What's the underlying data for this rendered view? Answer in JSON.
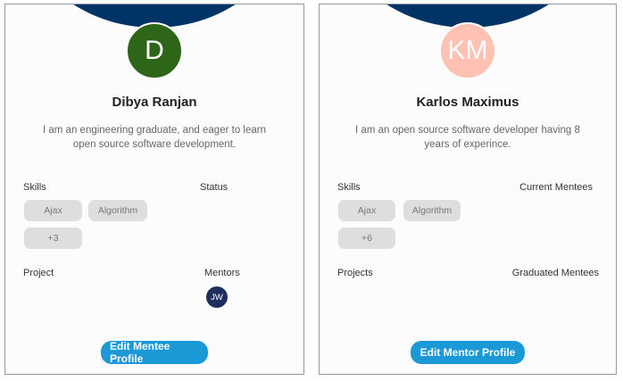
{
  "colors": {
    "banner": "#003466",
    "button": "#1a99d6",
    "chip_bg": "#dedede"
  },
  "mentee_card": {
    "avatar_initials": "D",
    "avatar_color": "#2e6619",
    "name": "Dibya Ranjan",
    "bio": "I am an engineering graduate, and eager to learn open source software development.",
    "skills_label": "Skills",
    "status_label": "Status",
    "skills": [
      "Ajax",
      "Algorithm"
    ],
    "more_skills": "+3",
    "project_label": "Project",
    "mentors_label": "Mentors",
    "mentor_initials": "JW",
    "mentor_color": "#1f2e5c",
    "button_label": "Edit Mentee Profile"
  },
  "mentor_card": {
    "avatar_initials": "KM",
    "avatar_color": "#ffc1b2",
    "name": "Karlos Maximus",
    "bio": "I am an open source software developer having 8 years of experince.",
    "skills_label": "Skills",
    "current_mentees_label": "Current Mentees",
    "skills": [
      "Ajax",
      "Algorithm"
    ],
    "more_skills": "+6",
    "projects_label": "Projects",
    "graduated_mentees_label": "Graduated Mentees",
    "button_label": "Edit Mentor Profile"
  }
}
